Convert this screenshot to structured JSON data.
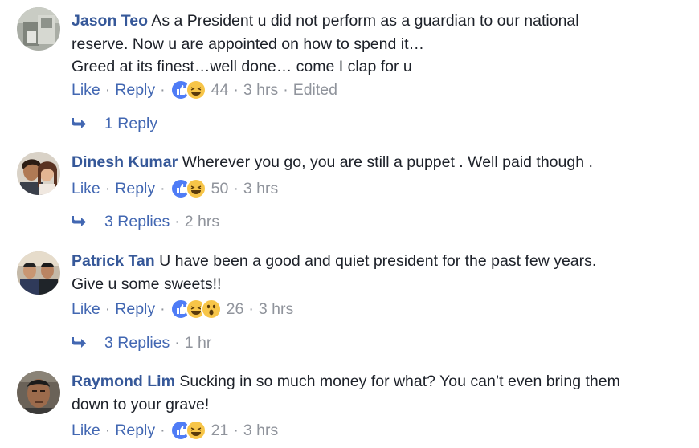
{
  "comments": [
    {
      "author": "Jason Teo",
      "lines": [
        "As a President u did not perform as a guardian to our national",
        "reserve. Now u are appointed on how to spend it…",
        "Greed at its finest…well done… come I clap for u"
      ],
      "like": "Like",
      "reply": "Reply",
      "reactions": [
        "like",
        "haha"
      ],
      "reaction_count": "44",
      "time": "3 hrs",
      "edited": "Edited",
      "replies": "1 Reply",
      "replies_time": ""
    },
    {
      "author": "Dinesh Kumar",
      "lines": [
        "Wherever you go, you are still a puppet . Well paid though ."
      ],
      "like": "Like",
      "reply": "Reply",
      "reactions": [
        "like",
        "haha"
      ],
      "reaction_count": "50",
      "time": "3 hrs",
      "replies": "3 Replies",
      "replies_time": "2 hrs"
    },
    {
      "author": "Patrick Tan",
      "lines": [
        "U have been a good and quiet president for the past few years.",
        "Give u some sweets!!"
      ],
      "like": "Like",
      "reply": "Reply",
      "reactions": [
        "like",
        "haha",
        "wow"
      ],
      "reaction_count": "26",
      "time": "3 hrs",
      "replies": "3 Replies",
      "replies_time": "1 hr"
    },
    {
      "author": "Raymond Lim",
      "lines": [
        "Sucking in so much money for what? You can’t even bring them",
        "down to your grave!"
      ],
      "like": "Like",
      "reply": "Reply",
      "reactions": [
        "like",
        "haha"
      ],
      "reaction_count": "21",
      "time": "3 hrs"
    }
  ],
  "colors": {
    "author": "#365899",
    "link": "#4267b2",
    "meta": "#90949c",
    "text": "#1d2129"
  },
  "icons": [
    "like-reaction-icon",
    "haha-reaction-icon",
    "wow-reaction-icon",
    "reply-arrow-icon"
  ]
}
